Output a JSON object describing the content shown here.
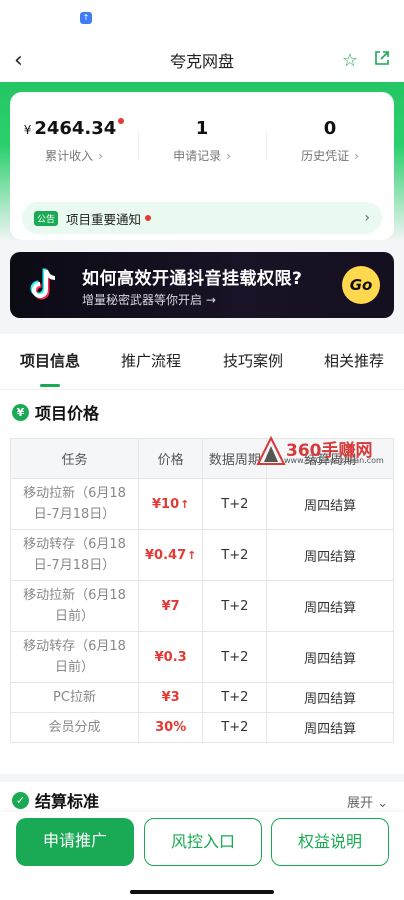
{
  "nav": {
    "title": "夸克网盘"
  },
  "summary": {
    "stats": [
      {
        "currency": "¥",
        "value": "2464.34",
        "label": "累计收入"
      },
      {
        "value": "1",
        "label": "申请记录"
      },
      {
        "value": "0",
        "label": "历史凭证"
      }
    ],
    "notice": {
      "tag": "公告",
      "text": "项目重要通知"
    }
  },
  "banner": {
    "title": "如何高效开通抖音挂载权限?",
    "subtitle": "增量秘密武器等你开启 →",
    "go_label": "Go"
  },
  "tabs": [
    "项目信息",
    "推广流程",
    "技巧案例",
    "相关推荐"
  ],
  "price_section": {
    "icon": "¥",
    "title": "项目价格",
    "headers": [
      "任务",
      "价格",
      "数据周期",
      "结算周期"
    ],
    "rows": [
      {
        "task": "移动拉新（6月18日-7月18日）",
        "price": "¥10",
        "up": "↑",
        "cycle": "T+2",
        "settle": "周四结算"
      },
      {
        "task": "移动转存（6月18日-7月18日）",
        "price": "¥0.47",
        "up": "↑",
        "cycle": "T+2",
        "settle": "周四结算"
      },
      {
        "task": "移动拉新（6月18日前）",
        "price": "¥7",
        "up": "",
        "cycle": "T+2",
        "settle": "周四结算"
      },
      {
        "task": "移动转存（6月18日前）",
        "price": "¥0.3",
        "up": "",
        "cycle": "T+2",
        "settle": "周四结算"
      },
      {
        "task": "PC拉新",
        "price": "¥3",
        "up": "",
        "cycle": "T+2",
        "settle": "周四结算"
      },
      {
        "task": "会员分成",
        "price": "30%",
        "up": "",
        "cycle": "T+2",
        "settle": "周四结算"
      }
    ]
  },
  "watermark": {
    "text": "360手赚网",
    "url": "www.360shouzhuan.com"
  },
  "settle_section": {
    "title": "结算标准",
    "expand_label": "展开"
  },
  "footer": {
    "apply_label": "申请推广",
    "risk_label": "风控入口",
    "rights_label": "权益说明"
  },
  "colors": {
    "brand": "#1aaa55",
    "price": "#e53935",
    "go": "#ffd84d"
  }
}
